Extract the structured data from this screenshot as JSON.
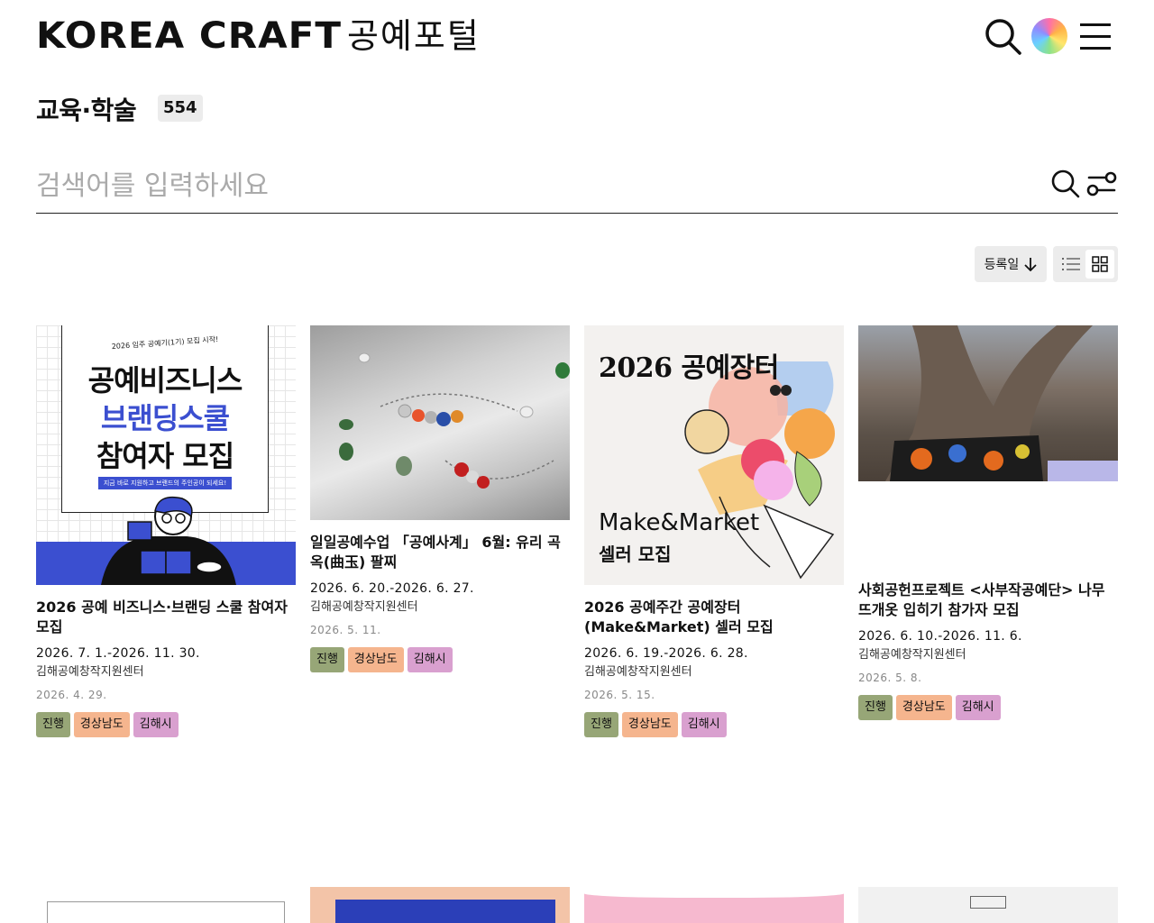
{
  "header": {
    "logo_text": "KOREA CRAFT",
    "logo_sub": "공예포털",
    "search_icon": "search-icon",
    "color_icon": "color-wheel-icon",
    "menu_icon": "hamburger-menu-icon"
  },
  "page": {
    "title": "교육·학술",
    "count": "554"
  },
  "search": {
    "placeholder": "검색어를 입력하세요",
    "value": ""
  },
  "toolbar": {
    "sort_label": "등록일",
    "sort_icon": "arrow-down-icon",
    "view_list_icon": "list-view-icon",
    "view_grid_icon": "grid-view-icon",
    "active_view": "grid"
  },
  "cards": [
    {
      "thumb": {
        "small": "2026 임주 공예기(1기) 모집 시작!",
        "line1": "공예비즈니스",
        "line2": "브랜딩스쿨",
        "line3": "참여자 모집",
        "strip": "지금 바로 지원하고 브랜드의 주인공이 되세요!"
      },
      "title": "2026 공예 비즈니스·브랜딩 스쿨 참여자 모집",
      "period": "2026. 7. 1.-2026. 11. 30.",
      "org": "김해공예창작지원센터",
      "registered": "2026. 4. 29.",
      "tags": [
        "진행",
        "경상남도",
        "김해시"
      ]
    },
    {
      "title": "일일공예수업 「공예사계」 6월: 유리 곡옥(曲玉) 팔찌",
      "period": "2026. 6. 20.-2026. 6. 27.",
      "org": "김해공예창작지원센터",
      "registered": "2026. 5. 11.",
      "tags": [
        "진행",
        "경상남도",
        "김해시"
      ]
    },
    {
      "thumb": {
        "top": "2026 공예장터",
        "bottom1": "Make&Market",
        "bottom2": "셀러 모집"
      },
      "title": "2026 공예주간 공예장터(Make&Market) 셀러 모집",
      "period": "2026. 6. 19.-2026. 6. 28.",
      "org": "김해공예창작지원센터",
      "registered": "2026. 5. 15.",
      "tags": [
        "진행",
        "경상남도",
        "김해시"
      ]
    },
    {
      "title": "사회공헌프로젝트 <사부작공예단> 나무뜨개옷 입히기 참가자 모집",
      "period": "2026. 6. 10.-2026. 11. 6.",
      "org": "김해공예창작지원센터",
      "registered": "2026. 5. 8.",
      "tags": [
        "진행",
        "경상남도",
        "김해시"
      ]
    }
  ],
  "colors": {
    "tag_status": "#97a677",
    "tag_region": "#f5b58e",
    "tag_city": "#d9a0cf",
    "accent_blue": "#3b4fd0"
  }
}
